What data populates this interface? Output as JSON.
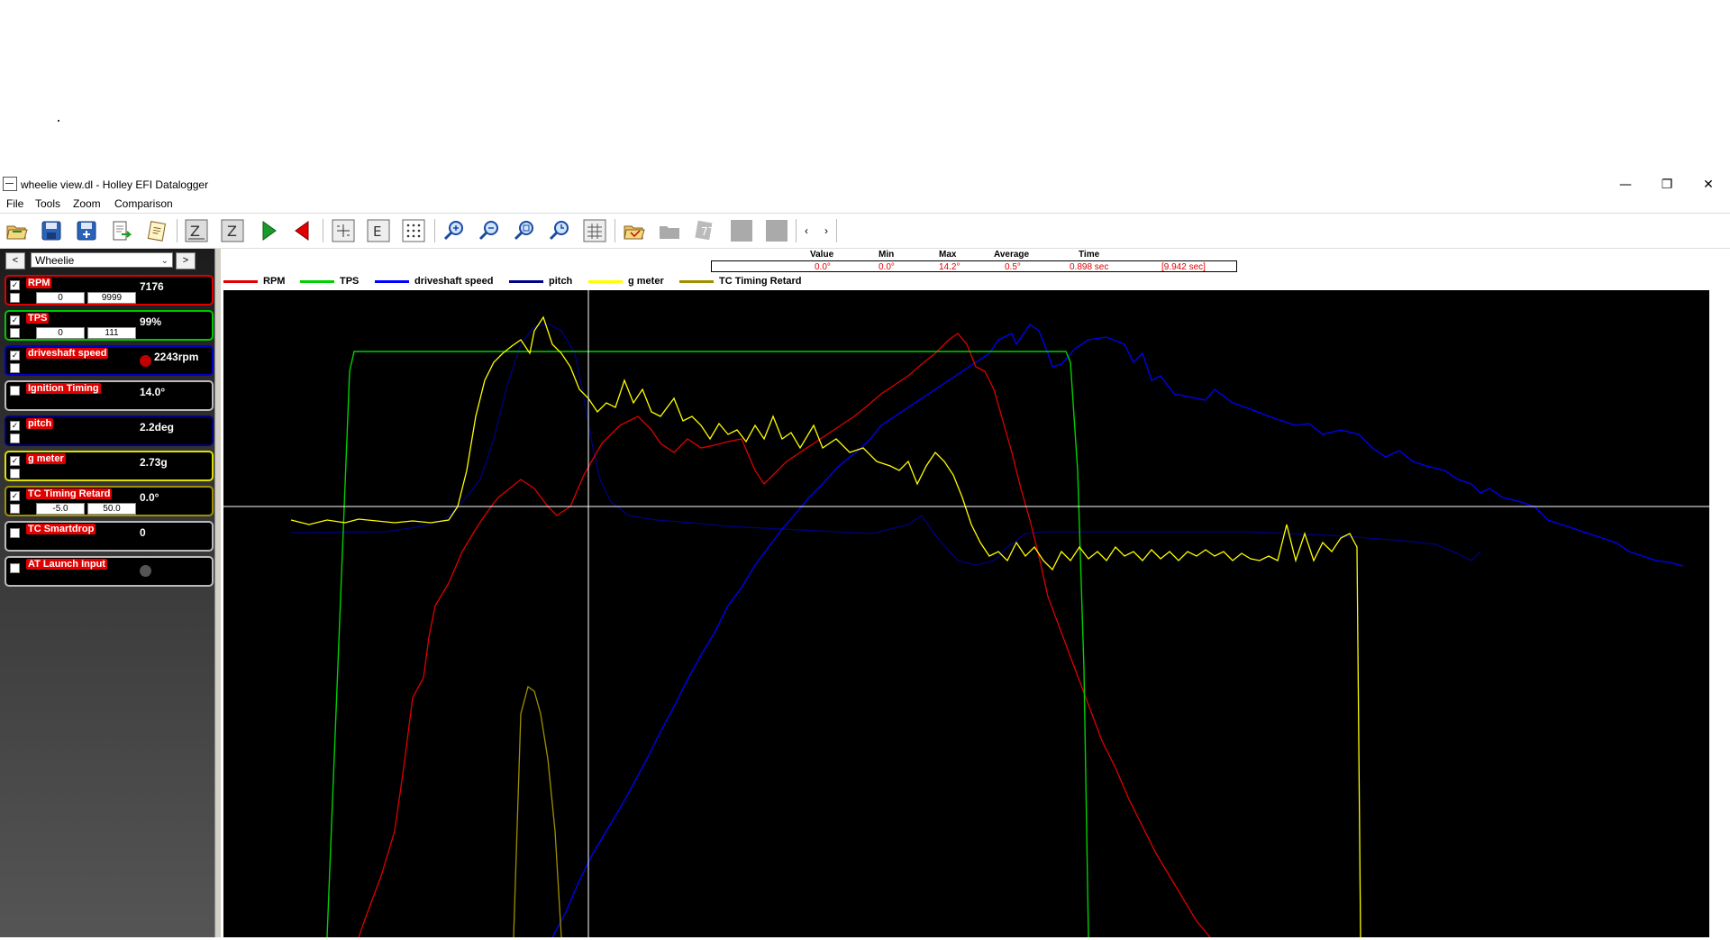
{
  "window": {
    "title": "wheelie view.dl - Holley EFI Datalogger",
    "minimize": "—",
    "restore": "❐",
    "close": "✕"
  },
  "menu": [
    "File",
    "Tools",
    "Zoom",
    "Comparison"
  ],
  "toolbar": {
    "buttons": [
      {
        "icon": "open-folder-icon"
      },
      {
        "icon": "save-icon"
      },
      {
        "icon": "save-as-icon"
      },
      {
        "icon": "export-icon"
      },
      {
        "icon": "notes-icon"
      },
      {
        "icon": "zoom-all-icon"
      },
      {
        "icon": "zoom-reset-icon"
      },
      {
        "icon": "play-forward-icon"
      },
      {
        "icon": "play-back-icon"
      },
      {
        "icon": "grid-icon"
      },
      {
        "icon": "event-icon"
      },
      {
        "icon": "dots-icon"
      },
      {
        "icon": "zoom-in-icon"
      },
      {
        "icon": "zoom-out-icon"
      },
      {
        "icon": "zoom-fit-icon"
      },
      {
        "icon": "zoom-time-icon"
      },
      {
        "icon": "table-icon"
      },
      {
        "icon": "compare-open-icon"
      },
      {
        "icon": "compare-disabled-icon"
      },
      {
        "icon": "compare-disabled-icon"
      },
      {
        "icon": "compare-disabled-icon"
      },
      {
        "icon": "compare-disabled-icon"
      }
    ],
    "scroll_left": "‹",
    "scroll_right": "›"
  },
  "sidebar": {
    "prev": "<",
    "next": ">",
    "preset": "Wheelie",
    "channels": [
      {
        "name": "RPM",
        "value": "7176",
        "checked": true,
        "border": "#e00000",
        "range_min": "0",
        "range_max": "9999"
      },
      {
        "name": "TPS",
        "value": "99%",
        "checked": true,
        "border": "#00c800",
        "range_min": "0",
        "range_max": "111"
      },
      {
        "name": "driveshaft speed",
        "value": "2243rpm",
        "checked": true,
        "border": "#0000c8",
        "led": "#c00000"
      },
      {
        "name": "Ignition Timing",
        "value": "14.0°",
        "checked": false,
        "border": "#bbbbbb"
      },
      {
        "name": "pitch",
        "value": "2.2deg",
        "checked": true,
        "border": "#000080"
      },
      {
        "name": "g meter",
        "value": "2.73g",
        "checked": true,
        "border": "#e0e000"
      },
      {
        "name": "TC Timing Retard",
        "value": "0.0°",
        "checked": true,
        "border": "#a09000",
        "range_min": "-5.0",
        "range_max": "50.0"
      },
      {
        "name": "TC Smartdrop",
        "value": "0",
        "checked": false,
        "border": "#bbbbbb"
      },
      {
        "name": "AT Launch Input",
        "value": "",
        "checked": false,
        "border": "#bbbbbb",
        "led": "#555555"
      }
    ]
  },
  "stats": {
    "headers": [
      "Value",
      "Min",
      "Max",
      "Average",
      "Time"
    ],
    "values": [
      "0.0°",
      "0.0°",
      "14.2°",
      "0.5°",
      "0.898 sec",
      "[9.942 sec]"
    ]
  },
  "legend": [
    {
      "name": "RPM",
      "color": "#e00000"
    },
    {
      "name": "TPS",
      "color": "#00d000"
    },
    {
      "name": "driveshaft speed",
      "color": "#0000ff"
    },
    {
      "name": "pitch",
      "color": "#000080"
    },
    {
      "name": "g meter",
      "color": "#ffff00"
    },
    {
      "name": "TC Timing Retard",
      "color": "#a09000"
    }
  ]
}
